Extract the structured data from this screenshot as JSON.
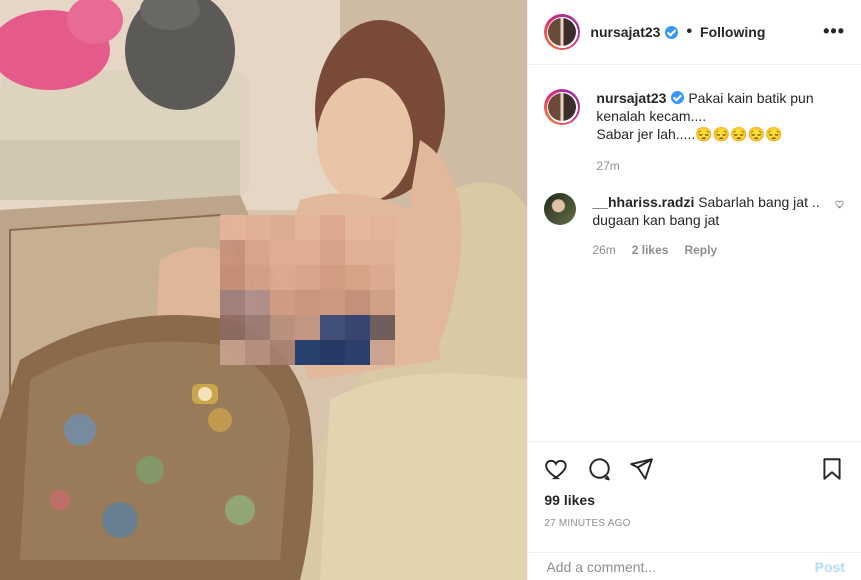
{
  "post": {
    "username": "nursajat23",
    "follow_status": "Following",
    "more_icon": "more-horizontal-icon",
    "verified_icon": "verified-badge-icon"
  },
  "caption": {
    "username": "nursajat23",
    "text_line1": "Pakai kain batik pun kenalah kecam....",
    "text_line2": "Sabar jer lah.....😔😔😔😔😔",
    "age": "27m"
  },
  "comments": [
    {
      "username": "__hhariss.radzi",
      "text": "Sabarlah bang jat .. dugaan kan bang jat",
      "age": "26m",
      "likes": "2 likes",
      "reply": "Reply"
    }
  ],
  "actions": {
    "like_icon": "heart-icon",
    "comment_icon": "comment-icon",
    "share_icon": "share-icon",
    "save_icon": "bookmark-icon"
  },
  "stats": {
    "likes": "99 likes",
    "timestamp": "27 MINUTES AGO"
  },
  "composer": {
    "placeholder": "Add a comment...",
    "post_label": "Post"
  },
  "colors": {
    "accent_blue": "#3897f0",
    "post_disabled": "#b2dffc",
    "muted": "#8e8e8e"
  }
}
